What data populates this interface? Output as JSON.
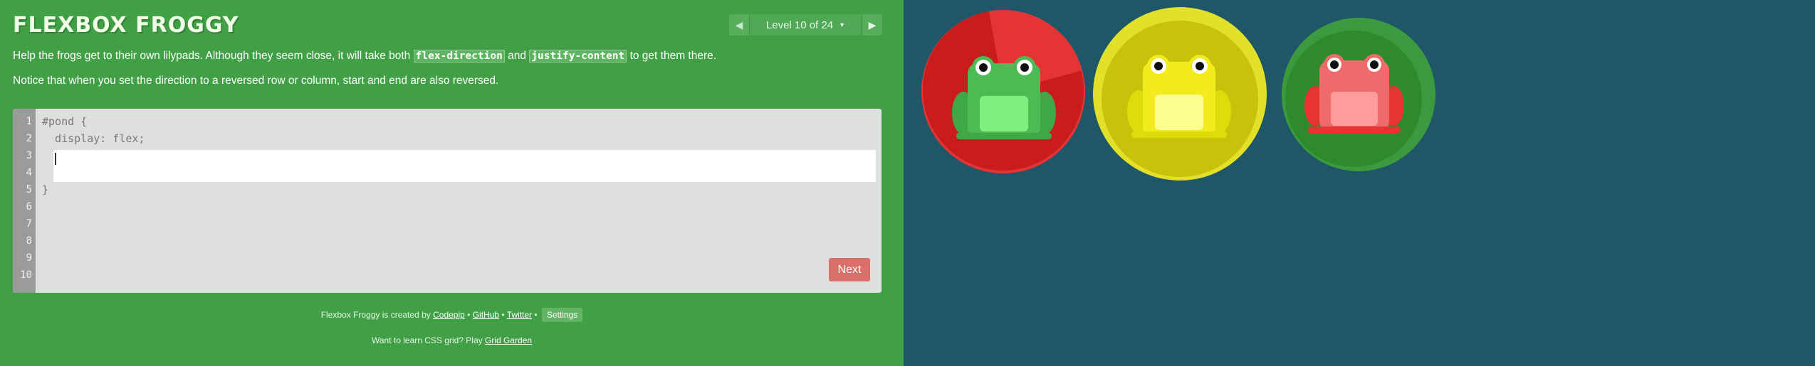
{
  "app": {
    "title": "FLEXBOX FROGGY"
  },
  "level_nav": {
    "prev_icon": "triangle-left-icon",
    "next_icon": "triangle-right-icon",
    "level_label": "Level 10 of 24",
    "current_level": 10,
    "total_levels": 24
  },
  "instructions": {
    "p1_before": "Help the frogs get to their own lilypads. Although they seem close, it will take both ",
    "p1_code1": "flex-direction",
    "p1_mid": " and ",
    "p1_code2": "justify-content",
    "p1_after": " to get them there.",
    "p2": "Notice that when you set the direction to a reversed row or column, start and end are also reversed."
  },
  "editor": {
    "line_numbers": [
      "1",
      "2",
      "3",
      "4",
      "5",
      "6",
      "7",
      "8",
      "9",
      "10"
    ],
    "line1": "#pond {",
    "line2": "  display: flex;",
    "line5": "}",
    "input_value": "",
    "next_label": "Next"
  },
  "footer": {
    "credits_prefix": "Flexbox Froggy is created by ",
    "codepip": "Codepip",
    "sep": " • ",
    "github": "GitHub",
    "twitter": "Twitter",
    "settings": "Settings",
    "promo_prefix": "Want to learn CSS grid? Play ",
    "grid_garden": "Grid Garden"
  },
  "board": {
    "lilypads": [
      {
        "color": "red"
      },
      {
        "color": "yellow"
      },
      {
        "color": "green"
      }
    ],
    "frogs": [
      {
        "color": "green"
      },
      {
        "color": "yellow"
      },
      {
        "color": "red"
      }
    ]
  },
  "colors": {
    "sidebar_bg": "#41a046",
    "board_bg": "#1f5768",
    "next_button": "#d9625a"
  }
}
